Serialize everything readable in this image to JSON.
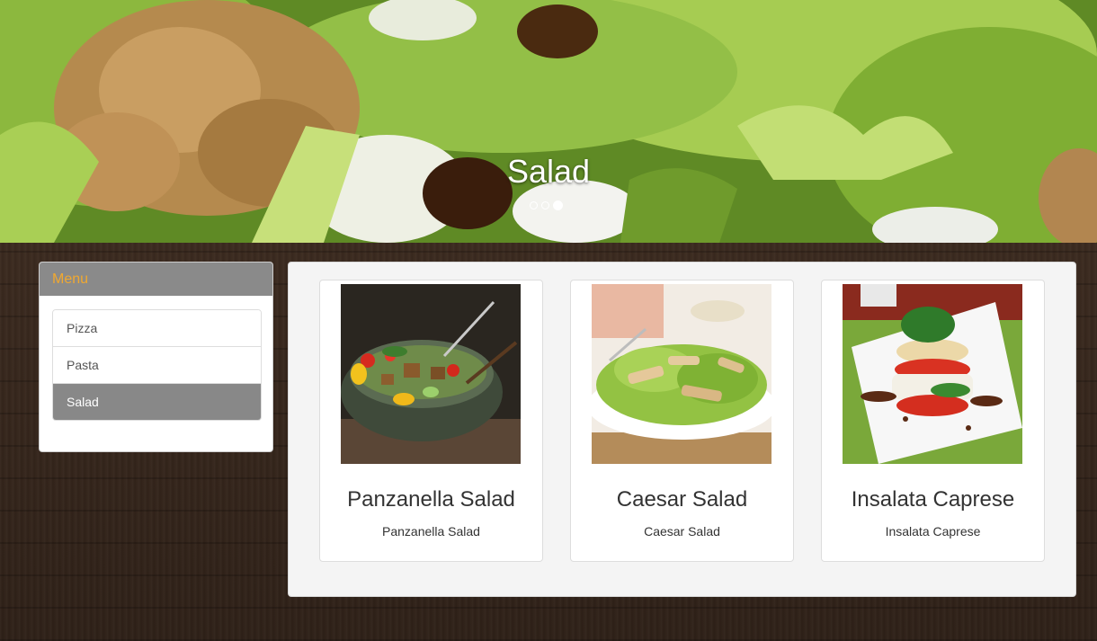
{
  "hero": {
    "title": "Salad",
    "slides": 3,
    "active_slide": 3
  },
  "menu": {
    "heading": "Menu",
    "items": [
      {
        "label": "Pizza",
        "active": false
      },
      {
        "label": "Pasta",
        "active": false
      },
      {
        "label": "Salad",
        "active": true
      }
    ]
  },
  "products": [
    {
      "title": "Panzanella Salad",
      "description": "Panzanella Salad",
      "image": "panzanella-salad-photo"
    },
    {
      "title": "Caesar Salad",
      "description": "Caesar Salad",
      "image": "caesar-salad-photo"
    },
    {
      "title": "Insalata Caprese",
      "description": "Insalata Caprese",
      "image": "insalata-caprese-photo"
    }
  ],
  "colors": {
    "menu_heading_bg": "#8a8a8a",
    "menu_heading_text": "#f0a830",
    "menu_active_bg": "#888888",
    "panel_bg": "#f4f4f4"
  }
}
